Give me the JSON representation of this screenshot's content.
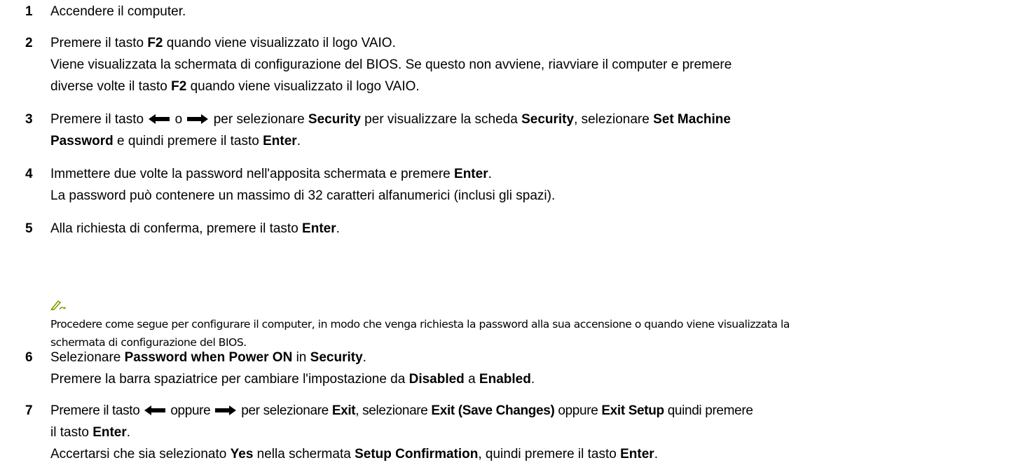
{
  "steps": [
    {
      "number": "1",
      "lines": [
        [
          "Accendere il computer."
        ]
      ]
    },
    {
      "number": "2",
      "lines": [
        [
          "Premere il tasto ",
          "F2",
          " quando viene visualizzato il logo VAIO."
        ],
        [
          "Viene visualizzata la schermata di configurazione del BIOS. Se questo non avviene, riavviare il computer e premere"
        ],
        [
          "diverse volte il tasto ",
          "F2",
          " quando viene visualizzato il logo VAIO."
        ]
      ]
    },
    {
      "number": "3",
      "lines": [
        [
          "Premere il tasto ",
          "",
          " o ",
          "",
          " per selezionare ",
          "Security",
          " per visualizzare la scheda ",
          "Security",
          ", selezionare ",
          "Set Machine"
        ],
        [
          "Password",
          " e quindi premere il tasto ",
          "Enter",
          "."
        ]
      ]
    },
    {
      "number": "4",
      "lines": [
        [
          "Immettere due volte la password nell'apposita schermata e premere ",
          "Enter",
          "."
        ],
        [
          "La password può contenere un massimo di 32 caratteri alfanumerici (inclusi gli spazi)."
        ]
      ]
    },
    {
      "number": "5",
      "lines": [
        [
          "Alla richiesta di conferma, premere il tasto ",
          "Enter",
          "."
        ]
      ]
    },
    {
      "number": "6",
      "lines": [
        [
          "Selezionare ",
          "Password when Power ON",
          " in ",
          "Security",
          "."
        ],
        [
          "Premere la barra spaziatrice per cambiare l'impostazione da ",
          "Disabled",
          " a ",
          "Enabled",
          "."
        ]
      ]
    },
    {
      "number": "7",
      "lines": [
        [
          "Premere il tasto ",
          "",
          " oppure ",
          "",
          " per selezionare ",
          "Exit",
          ", selezionare ",
          "Exit (Save Changes)",
          " oppure ",
          "Exit Setup",
          " quindi premere"
        ],
        [
          "il tasto ",
          "Enter",
          "."
        ],
        [
          "Accertarsi che sia selezionato ",
          "Yes",
          " nella schermata ",
          "Setup Confirmation",
          ", quindi premere il tasto ",
          "Enter",
          "."
        ]
      ]
    }
  ],
  "note": {
    "icon": "note-pencil-icon",
    "lines": [
      "Procedere come segue per configurare il computer, in modo che venga richiesta la password alla sua accensione o quando viene visualizzata la",
      "schermata di configurazione del BIOS."
    ]
  }
}
